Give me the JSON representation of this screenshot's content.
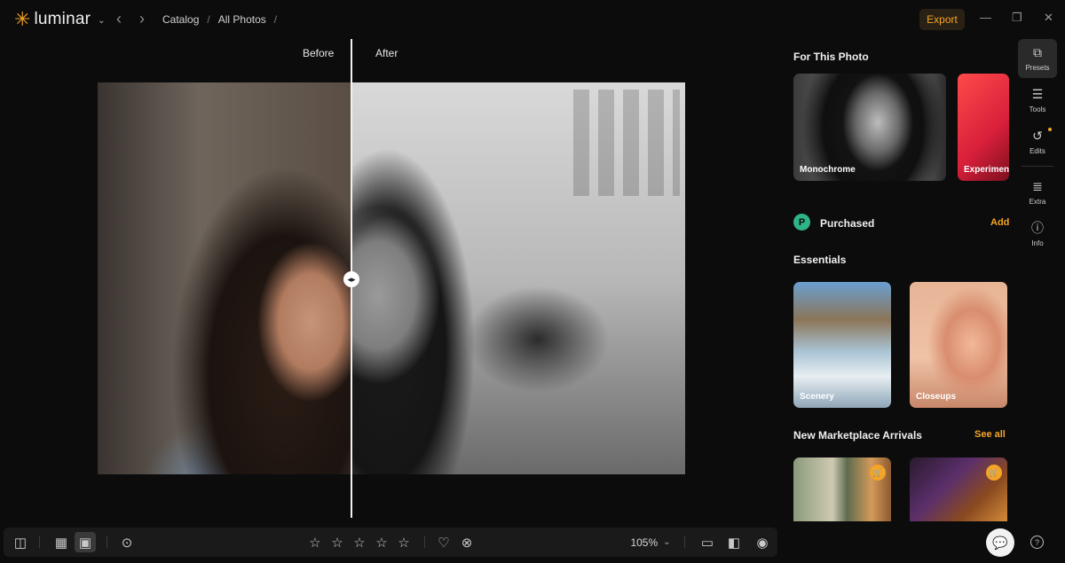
{
  "app": {
    "name": "luminar",
    "logo_icon": "sun-star-icon",
    "accent": "#f4a426"
  },
  "breadcrumb": {
    "items": [
      "Catalog",
      "All Photos"
    ],
    "separator": "/"
  },
  "header": {
    "export_label": "Export"
  },
  "window": {
    "minimize": "—",
    "restore": "❐",
    "close": "✕"
  },
  "compare": {
    "before_label": "Before",
    "after_label": "After"
  },
  "toolbar": {
    "zoom_label": "105%",
    "rating_stars": 5
  },
  "panel": {
    "for_this_photo": {
      "title": "For This Photo",
      "cards": [
        {
          "label": "Monochrome"
        },
        {
          "label": "Experimental"
        }
      ]
    },
    "purchased": {
      "title": "Purchased",
      "action": "Add",
      "icon_letter": "P"
    },
    "essentials": {
      "title": "Essentials",
      "cards": [
        {
          "label": "Scenery"
        },
        {
          "label": "Closeups"
        }
      ]
    },
    "marketplace": {
      "title": "New Marketplace Arrivals",
      "action": "See all"
    }
  },
  "rail": {
    "items": [
      {
        "label": "Presets",
        "icon": "presets-icon",
        "active": true
      },
      {
        "label": "Tools",
        "icon": "sliders-icon",
        "active": false
      },
      {
        "label": "Edits",
        "icon": "history-icon",
        "active": false
      },
      {
        "label": "Extra",
        "icon": "list-icon",
        "active": false
      },
      {
        "label": "Info",
        "icon": "info-icon",
        "active": false
      }
    ]
  }
}
